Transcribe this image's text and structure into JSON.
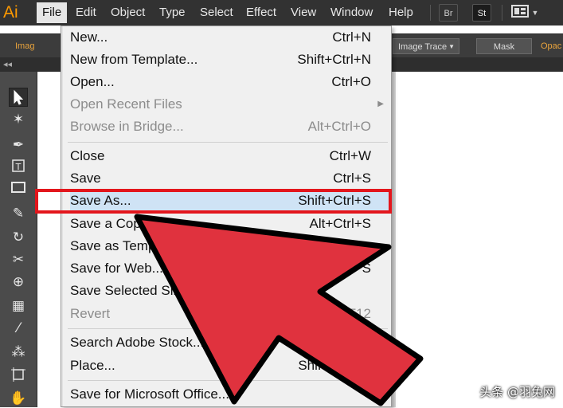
{
  "app": {
    "logo": "Ai"
  },
  "menubar": {
    "items": [
      "File",
      "Edit",
      "Object",
      "Type",
      "Select",
      "Effect",
      "View",
      "Window",
      "Help"
    ],
    "active": "File",
    "right_icons": [
      "Br",
      "St"
    ]
  },
  "controlbar": {
    "left_label": "Imag",
    "image_trace": "Image Trace",
    "mask": "Mask",
    "right_label": "Opac"
  },
  "strip": {
    "collapse": "◂◂"
  },
  "file_menu": {
    "items": [
      {
        "label": "New...",
        "shortcut": "Ctrl+N",
        "enabled": true
      },
      {
        "label": "New from Template...",
        "shortcut": "Shift+Ctrl+N",
        "enabled": true
      },
      {
        "label": "Open...",
        "shortcut": "Ctrl+O",
        "enabled": true
      },
      {
        "label": "Open Recent Files",
        "shortcut": "",
        "enabled": false,
        "submenu": true
      },
      {
        "label": "Browse in Bridge...",
        "shortcut": "Alt+Ctrl+O",
        "enabled": false
      },
      {
        "label": "Close",
        "shortcut": "Ctrl+W",
        "enabled": true
      },
      {
        "label": "Save",
        "shortcut": "Ctrl+S",
        "enabled": true
      },
      {
        "label": "Save As...",
        "shortcut": "Shift+Ctrl+S",
        "enabled": true,
        "highlighted": true
      },
      {
        "label": "Save a Copy...",
        "shortcut": "Alt+Ctrl+S",
        "enabled": true
      },
      {
        "label": "Save as Template...",
        "shortcut": "",
        "enabled": true
      },
      {
        "label": "Save for Web...",
        "shortcut": "S",
        "enabled": true
      },
      {
        "label": "Save Selected Slices...",
        "shortcut": "",
        "enabled": true
      },
      {
        "label": "Revert",
        "shortcut": "F12",
        "enabled": false
      },
      {
        "label": "Search Adobe Stock...",
        "shortcut": "",
        "enabled": true
      },
      {
        "label": "Place...",
        "shortcut": "Shift+Ctrl+P",
        "enabled": true
      },
      {
        "label": "Save for Microsoft Office...",
        "shortcut": "",
        "enabled": true
      }
    ]
  },
  "watermark": "头条 @羽兔网",
  "colors": {
    "highlight_box": "#e3161c",
    "arrow_fill": "#e0323e",
    "logo": "#ff9a00"
  }
}
